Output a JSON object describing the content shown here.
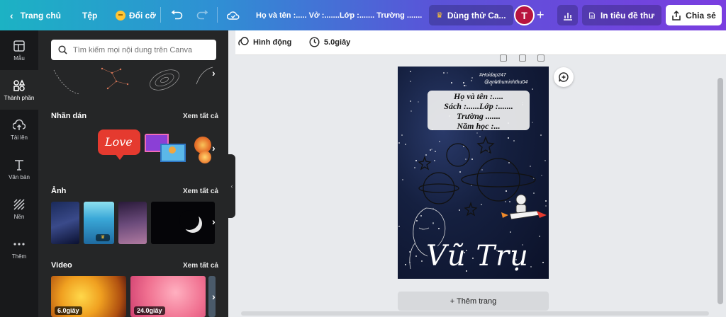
{
  "topbar": {
    "home": "Trang chủ",
    "file": "Tệp",
    "resize": "Đổi cỡ",
    "doc_title": "Họ và tên :..... Vở :.......Lớp :....... Trường .......",
    "try_pro": "Dùng thử Ca...",
    "avatar_letter": "T",
    "print": "In tiêu đề thư",
    "share": "Chia sẻ"
  },
  "rail": {
    "items": [
      {
        "label": "Mẫu",
        "icon": "template-icon"
      },
      {
        "label": "Thành phần",
        "icon": "elements-icon"
      },
      {
        "label": "Tải lên",
        "icon": "upload-icon"
      },
      {
        "label": "Văn bản",
        "icon": "text-icon"
      },
      {
        "label": "Nền",
        "icon": "background-icon"
      },
      {
        "label": "Thêm",
        "icon": "more-icon"
      }
    ]
  },
  "panel": {
    "search_placeholder": "Tìm kiếm mọi nội dung trên Canva",
    "stickers_title": "Nhãn dán",
    "photos_title": "Ảnh",
    "videos_title": "Video",
    "see_all": "Xem tất cả",
    "sticker_love": "Love",
    "video_durations": [
      "6.0giây",
      "24.0giây"
    ]
  },
  "toolbar2": {
    "animate": "Hình động",
    "duration": "5.0giây"
  },
  "design": {
    "tag1": "#Hoidap247",
    "tag2": "@anhthuminhthu04",
    "card_lines": [
      "Họ và tên :.....",
      "Sách :......Lớp :.......",
      "Trường .......",
      "Năm học :..."
    ],
    "title": "Vũ Trụ"
  },
  "add_page": "+ Thêm trang",
  "colors": {
    "brand_start": "#1cb2c4",
    "brand_end": "#7a3ee0",
    "panel_bg": "#252627",
    "rail_bg": "#18191b",
    "avatar": "#b8143f"
  }
}
